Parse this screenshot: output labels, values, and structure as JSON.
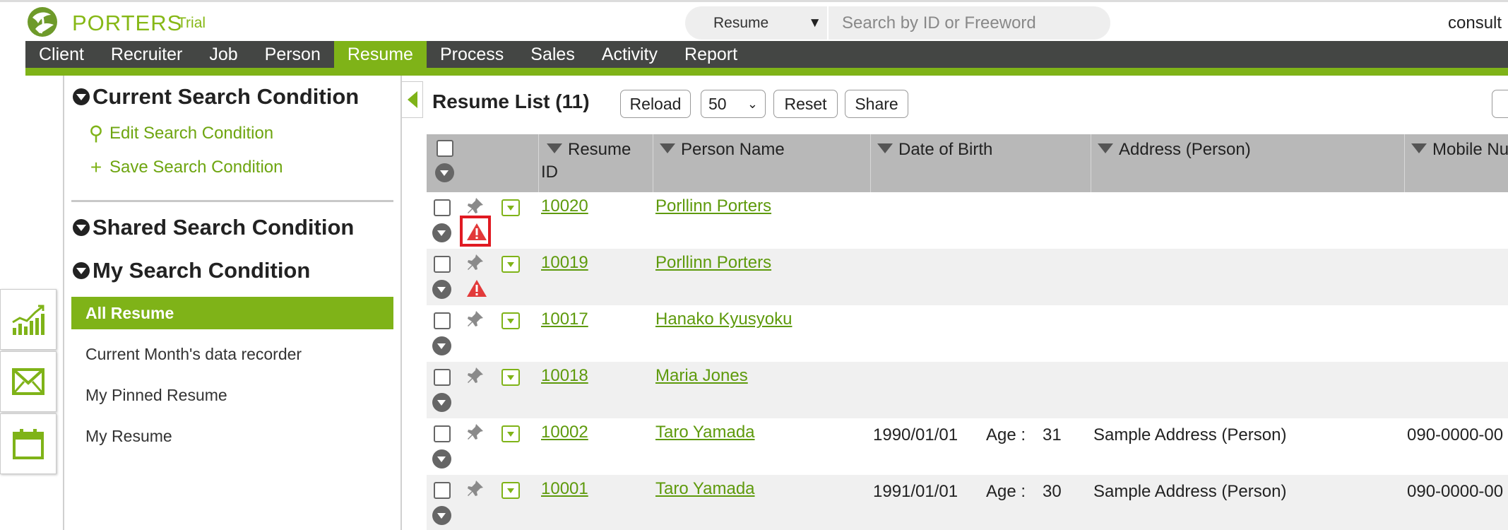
{
  "header": {
    "brand": "PORTERS",
    "edition": "Trial",
    "search_scope": "Resume",
    "search_placeholder": "Search by ID or Freeword",
    "user": "consult"
  },
  "nav": {
    "items": [
      "Client",
      "Recruiter",
      "Job",
      "Person",
      "Resume",
      "Process",
      "Sales",
      "Activity",
      "Report"
    ],
    "active": "Resume"
  },
  "side_widgets": [
    "chart-icon",
    "mail-icon",
    "calendar-icon"
  ],
  "panel": {
    "current_title": "Current Search Condition",
    "edit_label": "Edit Search Condition",
    "save_label": "Save Search Condition",
    "shared_title": "Shared Search Condition",
    "my_title": "My Search Condition",
    "conditions": [
      "All Resume",
      "Current Month's data recorder",
      "My Pinned Resume",
      "My Resume"
    ],
    "active_condition": "All Resume"
  },
  "list": {
    "title": "Resume List (11)",
    "reload": "Reload",
    "page_size": "50",
    "reset": "Reset",
    "share": "Share",
    "columns": {
      "resume_id": "Resume ID",
      "resume_id_line1": "Resume",
      "resume_id_line2": "ID",
      "person_name": "Person Name",
      "dob": "Date of Birth",
      "address": "Address (Person)",
      "mobile": "Mobile Nu"
    },
    "rows": [
      {
        "id": "10020",
        "name": "Porllinn Porters",
        "dob": "",
        "age_label": "",
        "age": "",
        "address": "",
        "mobile": "",
        "warning": true,
        "highlight": true
      },
      {
        "id": "10019",
        "name": "Porllinn Porters",
        "dob": "",
        "age_label": "",
        "age": "",
        "address": "",
        "mobile": "",
        "warning": true,
        "highlight": false
      },
      {
        "id": "10017",
        "name": "Hanako Kyusyoku",
        "dob": "",
        "age_label": "",
        "age": "",
        "address": "",
        "mobile": "",
        "warning": false,
        "highlight": false
      },
      {
        "id": "10018",
        "name": "Maria Jones",
        "dob": "",
        "age_label": "",
        "age": "",
        "address": "",
        "mobile": "",
        "warning": false,
        "highlight": false
      },
      {
        "id": "10002",
        "name": "Taro Yamada",
        "dob": "1990/01/01",
        "age_label": "Age :",
        "age": "31",
        "address": "Sample Address (Person)",
        "mobile": "090-0000-00",
        "warning": false,
        "highlight": false
      },
      {
        "id": "10001",
        "name": "Taro Yamada",
        "dob": "1991/01/01",
        "age_label": "Age :",
        "age": "30",
        "address": "Sample Address (Person)",
        "mobile": "090-0000-00",
        "warning": false,
        "highlight": false
      }
    ]
  },
  "colors": {
    "accent": "#7fb318",
    "nav_bg": "#444644",
    "link": "#5e9a0c",
    "warning": "#e01a22"
  }
}
